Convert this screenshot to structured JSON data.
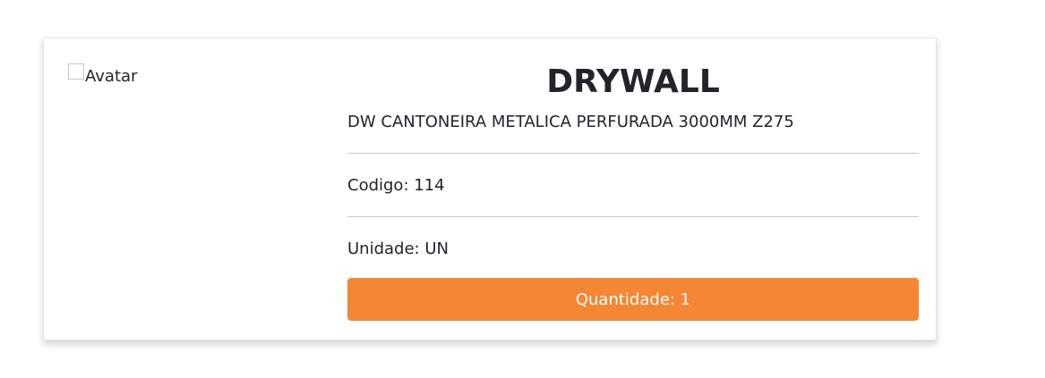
{
  "product": {
    "avatar_alt": "Avatar",
    "title": "DRYWALL",
    "description": "DW CANTONEIRA METALICA PERFURADA 3000MM Z275",
    "code_text": "Codigo: 114",
    "unit_text": "Unidade: UN",
    "quantity_button": "Quantidade: 1"
  },
  "colors": {
    "accent": "#f58634",
    "text": "#212529",
    "divider": "#c9c9c9"
  }
}
